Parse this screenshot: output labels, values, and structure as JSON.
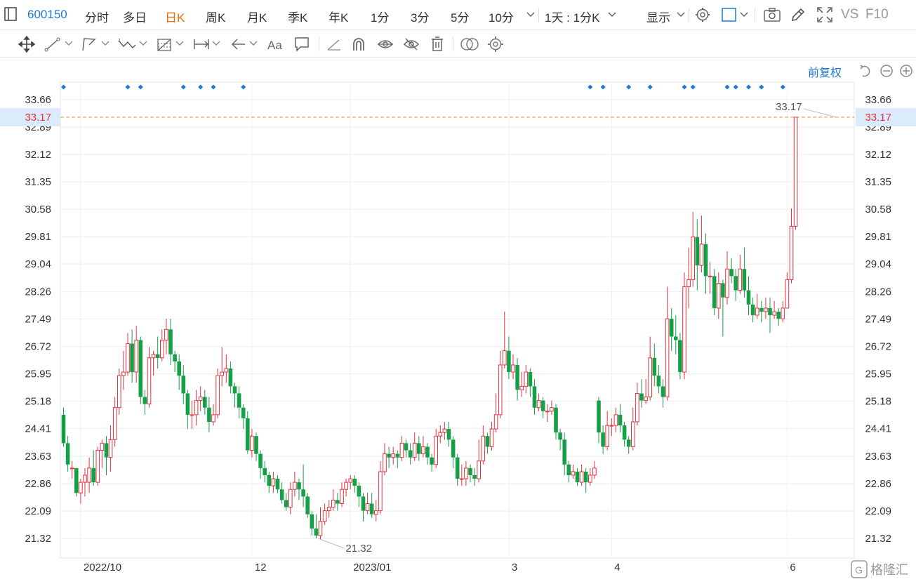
{
  "toolbar": {
    "stock_code": "600150",
    "periods": [
      "分时",
      "多日",
      "日K",
      "周K",
      "月K",
      "季K",
      "年K",
      "1分",
      "3分",
      "5分",
      "10分"
    ],
    "selected_period": "日K",
    "interval_select": "1天 : 1分K",
    "display_label": "显示",
    "vs_label": "VS",
    "f10_label": "F10"
  },
  "drawing_tools": [
    "move-icon",
    "line-icon",
    "polyline-icon",
    "wave-icon",
    "fib-icon",
    "range-icon",
    "arrow-icon",
    "text-icon",
    "comment-icon",
    "ruler-icon",
    "magnet-icon",
    "eye-icon",
    "hide-icon",
    "trash-icon",
    "compare-icon",
    "settings-icon"
  ],
  "adjust_label": "前复权",
  "colors": {
    "up": "#e5323f",
    "down": "#14a046",
    "accent": "#1e78d8",
    "selected": "#f06a00",
    "dash": "#f0a050"
  },
  "watermark": "格隆汇",
  "chart_data": {
    "type": "candlestick",
    "symbol": "600150",
    "y_ticks": [
      33.66,
      32.89,
      32.12,
      31.35,
      30.58,
      29.81,
      29.04,
      28.26,
      27.49,
      26.72,
      25.95,
      25.18,
      24.41,
      23.63,
      22.86,
      22.09,
      21.32
    ],
    "ylim": [
      20.75,
      33.9
    ],
    "x_labels": [
      "2022/10",
      "12",
      "2023/01",
      "3",
      "4",
      "6"
    ],
    "x_label_index": [
      4,
      44,
      67,
      104,
      128,
      169
    ],
    "last_price": 33.17,
    "annotations": [
      {
        "text": "33.17",
        "index": 181,
        "value": 33.17
      },
      {
        "text": "21.32",
        "index": 59,
        "value": 21.32
      }
    ],
    "event_marker_index": [
      0,
      15,
      18,
      28,
      32,
      35,
      42,
      123,
      126,
      132,
      137,
      145,
      147,
      155,
      157,
      160,
      163,
      168
    ],
    "candles": [
      [
        24.8,
        24.0,
        25.0,
        23.9
      ],
      [
        24.0,
        23.4,
        24.2,
        23.2
      ],
      [
        23.3,
        23.3,
        23.5,
        23.0
      ],
      [
        23.3,
        22.6,
        23.3,
        22.5
      ],
      [
        22.6,
        22.9,
        23.0,
        22.3
      ],
      [
        22.9,
        23.1,
        23.3,
        22.5
      ],
      [
        22.9,
        23.3,
        23.6,
        22.6
      ],
      [
        23.3,
        22.9,
        23.8,
        22.8
      ],
      [
        22.9,
        23.8,
        23.9,
        22.8
      ],
      [
        23.8,
        24.0,
        24.1,
        23.3
      ],
      [
        24.0,
        23.6,
        24.2,
        23.1
      ],
      [
        23.6,
        24.1,
        24.5,
        23.2
      ],
      [
        24.1,
        25.0,
        25.3,
        23.9
      ],
      [
        25.0,
        25.9,
        26.1,
        24.8
      ],
      [
        25.9,
        26.0,
        26.6,
        25.5
      ],
      [
        26.0,
        26.8,
        27.1,
        25.9
      ],
      [
        26.8,
        26.0,
        27.2,
        25.7
      ],
      [
        26.0,
        26.9,
        27.3,
        25.7
      ],
      [
        26.9,
        25.3,
        27.0,
        25.1
      ],
      [
        25.3,
        25.1,
        25.5,
        24.8
      ],
      [
        25.1,
        26.4,
        26.7,
        25.0
      ],
      [
        26.4,
        26.5,
        26.6,
        25.9
      ],
      [
        26.5,
        26.4,
        27.0,
        26.1
      ],
      [
        26.4,
        26.9,
        27.2,
        26.3
      ],
      [
        26.9,
        27.2,
        27.5,
        26.5
      ],
      [
        27.2,
        26.5,
        27.5,
        26.2
      ],
      [
        26.5,
        26.3,
        26.6,
        26.0
      ],
      [
        26.3,
        25.9,
        26.5,
        25.5
      ],
      [
        25.9,
        25.4,
        26.2,
        25.1
      ],
      [
        25.4,
        24.8,
        25.5,
        24.4
      ],
      [
        24.8,
        24.8,
        25.2,
        24.4
      ],
      [
        24.8,
        25.2,
        25.5,
        24.5
      ],
      [
        25.2,
        25.3,
        25.6,
        24.9
      ],
      [
        25.3,
        25.0,
        25.5,
        24.8
      ],
      [
        25.0,
        24.6,
        25.3,
        24.3
      ],
      [
        24.6,
        24.8,
        25.1,
        24.5
      ],
      [
        24.8,
        25.9,
        26.1,
        24.7
      ],
      [
        25.9,
        26.0,
        26.7,
        25.6
      ],
      [
        26.0,
        26.1,
        26.5,
        25.7
      ],
      [
        26.1,
        25.6,
        26.3,
        25.4
      ],
      [
        25.6,
        25.4,
        25.7,
        25.0
      ],
      [
        25.4,
        25.0,
        25.6,
        24.7
      ],
      [
        25.0,
        24.7,
        25.1,
        24.4
      ],
      [
        24.7,
        23.8,
        24.9,
        23.7
      ],
      [
        23.8,
        24.2,
        24.4,
        23.6
      ],
      [
        24.2,
        23.7,
        24.3,
        23.5
      ],
      [
        23.7,
        23.3,
        23.8,
        23.0
      ],
      [
        23.3,
        23.1,
        23.5,
        22.9
      ],
      [
        23.1,
        22.8,
        23.2,
        22.6
      ],
      [
        22.8,
        23.0,
        23.2,
        22.6
      ],
      [
        23.0,
        22.7,
        23.1,
        22.6
      ],
      [
        22.7,
        22.4,
        22.9,
        22.3
      ],
      [
        22.4,
        22.2,
        22.6,
        22.1
      ],
      [
        22.2,
        22.7,
        22.9,
        22.0
      ],
      [
        22.7,
        22.9,
        23.2,
        22.5
      ],
      [
        22.9,
        22.7,
        23.0,
        22.4
      ],
      [
        22.7,
        22.5,
        23.4,
        22.2
      ],
      [
        22.5,
        22.0,
        22.6,
        21.9
      ],
      [
        22.0,
        21.6,
        22.1,
        21.4
      ],
      [
        21.6,
        21.4,
        22.0,
        21.32
      ],
      [
        21.4,
        21.8,
        22.2,
        21.3
      ],
      [
        21.8,
        22.1,
        22.3,
        21.7
      ],
      [
        22.1,
        22.2,
        22.4,
        21.9
      ],
      [
        22.2,
        22.4,
        22.7,
        22.1
      ],
      [
        22.4,
        22.3,
        22.6,
        22.1
      ],
      [
        22.3,
        22.7,
        22.9,
        22.2
      ],
      [
        22.7,
        22.9,
        23.0,
        22.5
      ],
      [
        22.9,
        23.0,
        23.1,
        22.7
      ],
      [
        23.0,
        22.8,
        23.1,
        22.6
      ],
      [
        22.8,
        22.5,
        22.9,
        22.2
      ],
      [
        22.5,
        22.1,
        22.6,
        21.8
      ],
      [
        22.1,
        22.3,
        22.6,
        22.0
      ],
      [
        22.3,
        22.0,
        22.6,
        21.9
      ],
      [
        22.0,
        22.1,
        22.4,
        21.8
      ],
      [
        22.1,
        23.2,
        23.5,
        22.0
      ],
      [
        23.2,
        23.7,
        24.0,
        23.1
      ],
      [
        23.7,
        23.6,
        23.9,
        23.3
      ],
      [
        23.6,
        23.7,
        23.9,
        23.4
      ],
      [
        23.7,
        23.6,
        23.8,
        23.3
      ],
      [
        23.6,
        24.0,
        24.2,
        23.5
      ],
      [
        24.0,
        23.8,
        24.1,
        23.6
      ],
      [
        23.8,
        23.6,
        24.0,
        23.4
      ],
      [
        23.6,
        24.0,
        24.3,
        23.5
      ],
      [
        24.0,
        23.7,
        24.2,
        23.5
      ],
      [
        23.7,
        23.9,
        24.2,
        23.6
      ],
      [
        23.9,
        23.6,
        24.0,
        23.4
      ],
      [
        23.6,
        23.4,
        23.7,
        23.2
      ],
      [
        23.4,
        24.2,
        24.4,
        23.3
      ],
      [
        24.2,
        24.3,
        24.5,
        24.0
      ],
      [
        24.3,
        24.4,
        24.6,
        24.1
      ],
      [
        24.4,
        24.1,
        24.6,
        23.9
      ],
      [
        24.1,
        23.6,
        24.2,
        23.3
      ],
      [
        23.6,
        23.0,
        23.7,
        22.8
      ],
      [
        23.0,
        23.0,
        23.4,
        22.8
      ],
      [
        23.0,
        23.3,
        23.5,
        22.8
      ],
      [
        23.3,
        23.1,
        23.4,
        22.9
      ],
      [
        23.1,
        23.0,
        23.3,
        22.8
      ],
      [
        23.0,
        23.5,
        24.1,
        22.9
      ],
      [
        23.5,
        24.2,
        24.5,
        23.4
      ],
      [
        24.2,
        23.9,
        24.3,
        23.7
      ],
      [
        23.9,
        24.4,
        24.6,
        23.8
      ],
      [
        24.4,
        24.8,
        25.4,
        24.3
      ],
      [
        24.8,
        26.2,
        26.6,
        24.7
      ],
      [
        26.2,
        26.6,
        27.7,
        26.1
      ],
      [
        26.6,
        26.0,
        27.0,
        25.8
      ],
      [
        26.0,
        26.2,
        26.5,
        25.8
      ],
      [
        26.2,
        25.5,
        26.4,
        25.2
      ],
      [
        25.5,
        25.6,
        26.0,
        25.3
      ],
      [
        25.6,
        26.0,
        26.2,
        25.4
      ],
      [
        26.0,
        25.6,
        26.1,
        25.3
      ],
      [
        25.6,
        25.0,
        25.8,
        24.8
      ],
      [
        25.0,
        25.2,
        25.4,
        24.9
      ],
      [
        25.2,
        24.9,
        25.3,
        24.7
      ],
      [
        24.9,
        24.9,
        25.1,
        24.6
      ],
      [
        24.9,
        25.0,
        25.2,
        24.8
      ],
      [
        25.0,
        24.3,
        25.1,
        24.1
      ],
      [
        24.3,
        24.1,
        24.4,
        23.8
      ],
      [
        24.1,
        23.4,
        24.3,
        23.1
      ],
      [
        23.4,
        23.1,
        23.5,
        22.9
      ],
      [
        23.1,
        23.2,
        23.4,
        23.0
      ],
      [
        23.2,
        22.9,
        23.3,
        22.8
      ],
      [
        22.9,
        23.2,
        23.4,
        22.8
      ],
      [
        23.2,
        22.9,
        23.3,
        22.6
      ],
      [
        22.9,
        23.1,
        23.3,
        22.8
      ],
      [
        23.1,
        23.3,
        23.5,
        23.0
      ],
      [
        25.2,
        24.3,
        25.3,
        24.0
      ],
      [
        24.3,
        23.9,
        24.5,
        23.7
      ],
      [
        23.9,
        24.5,
        24.9,
        23.8
      ],
      [
        24.5,
        24.5,
        24.7,
        24.2
      ],
      [
        24.5,
        24.8,
        25.0,
        24.3
      ],
      [
        24.8,
        24.5,
        25.1,
        24.3
      ],
      [
        24.5,
        24.1,
        24.6,
        23.9
      ],
      [
        24.1,
        23.9,
        24.2,
        23.7
      ],
      [
        23.9,
        24.6,
        25.0,
        23.8
      ],
      [
        24.6,
        25.4,
        25.7,
        24.5
      ],
      [
        25.4,
        25.2,
        25.8,
        25.0
      ],
      [
        25.2,
        25.3,
        25.8,
        25.1
      ],
      [
        25.3,
        26.4,
        27.0,
        25.2
      ],
      [
        26.4,
        25.9,
        26.8,
        25.6
      ],
      [
        25.9,
        25.6,
        26.2,
        25.4
      ],
      [
        25.6,
        25.3,
        25.8,
        25.0
      ],
      [
        25.3,
        27.5,
        28.4,
        25.2
      ],
      [
        27.5,
        27.0,
        27.8,
        26.6
      ],
      [
        27.0,
        26.9,
        27.6,
        26.5
      ],
      [
        26.9,
        26.0,
        27.1,
        25.8
      ],
      [
        26.0,
        28.4,
        28.8,
        25.8
      ],
      [
        28.4,
        28.6,
        29.5,
        27.8
      ],
      [
        28.6,
        29.8,
        30.5,
        28.4
      ],
      [
        29.8,
        29.0,
        30.3,
        28.3
      ],
      [
        29.0,
        29.6,
        30.4,
        28.8
      ],
      [
        29.6,
        28.7,
        29.9,
        28.2
      ],
      [
        28.7,
        28.7,
        29.1,
        28.2
      ],
      [
        28.7,
        27.8,
        28.9,
        27.6
      ],
      [
        27.8,
        28.5,
        28.8,
        27.5
      ],
      [
        28.5,
        28.1,
        28.6,
        27.0
      ],
      [
        28.1,
        28.9,
        29.4,
        27.9
      ],
      [
        28.9,
        28.7,
        29.2,
        28.5
      ],
      [
        28.7,
        28.3,
        28.9,
        28.0
      ],
      [
        28.3,
        28.9,
        29.3,
        28.2
      ],
      [
        28.9,
        28.3,
        29.5,
        28.1
      ],
      [
        28.3,
        27.9,
        28.7,
        27.6
      ],
      [
        27.9,
        27.6,
        28.1,
        27.4
      ],
      [
        27.6,
        27.8,
        28.2,
        27.5
      ],
      [
        27.8,
        27.7,
        28.0,
        27.4
      ],
      [
        27.7,
        27.8,
        28.1,
        27.5
      ],
      [
        27.8,
        27.6,
        28.1,
        27.1
      ],
      [
        27.6,
        27.7,
        28.0,
        27.5
      ],
      [
        27.7,
        27.5,
        27.8,
        27.3
      ],
      [
        27.5,
        27.8,
        28.0,
        27.4
      ],
      [
        27.8,
        28.6,
        28.8,
        27.8
      ],
      [
        28.6,
        30.1,
        30.6,
        28.5
      ],
      [
        30.1,
        33.17,
        33.17,
        30.0
      ]
    ]
  }
}
